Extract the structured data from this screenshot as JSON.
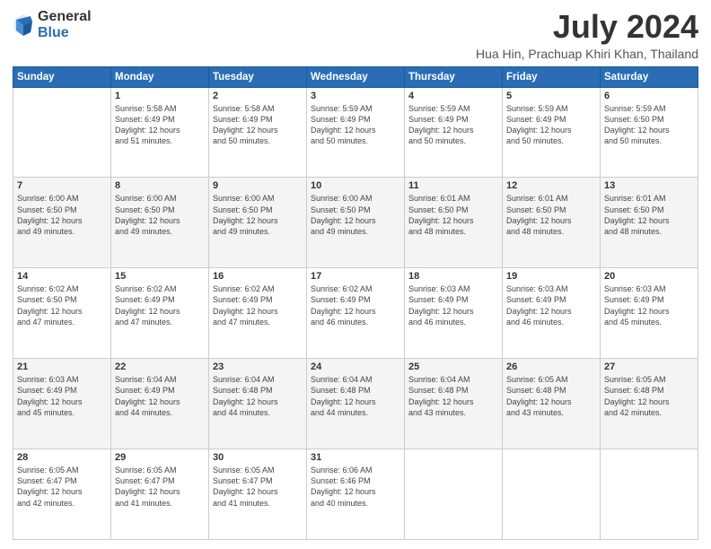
{
  "logo": {
    "general": "General",
    "blue": "Blue"
  },
  "title": "July 2024",
  "subtitle": "Hua Hin, Prachuap Khiri Khan, Thailand",
  "headers": [
    "Sunday",
    "Monday",
    "Tuesday",
    "Wednesday",
    "Thursday",
    "Friday",
    "Saturday"
  ],
  "weeks": [
    [
      {
        "day": "",
        "info": ""
      },
      {
        "day": "1",
        "info": "Sunrise: 5:58 AM\nSunset: 6:49 PM\nDaylight: 12 hours\nand 51 minutes."
      },
      {
        "day": "2",
        "info": "Sunrise: 5:58 AM\nSunset: 6:49 PM\nDaylight: 12 hours\nand 50 minutes."
      },
      {
        "day": "3",
        "info": "Sunrise: 5:59 AM\nSunset: 6:49 PM\nDaylight: 12 hours\nand 50 minutes."
      },
      {
        "day": "4",
        "info": "Sunrise: 5:59 AM\nSunset: 6:49 PM\nDaylight: 12 hours\nand 50 minutes."
      },
      {
        "day": "5",
        "info": "Sunrise: 5:59 AM\nSunset: 6:49 PM\nDaylight: 12 hours\nand 50 minutes."
      },
      {
        "day": "6",
        "info": "Sunrise: 5:59 AM\nSunset: 6:50 PM\nDaylight: 12 hours\nand 50 minutes."
      }
    ],
    [
      {
        "day": "7",
        "info": "Sunrise: 6:00 AM\nSunset: 6:50 PM\nDaylight: 12 hours\nand 49 minutes."
      },
      {
        "day": "8",
        "info": "Sunrise: 6:00 AM\nSunset: 6:50 PM\nDaylight: 12 hours\nand 49 minutes."
      },
      {
        "day": "9",
        "info": "Sunrise: 6:00 AM\nSunset: 6:50 PM\nDaylight: 12 hours\nand 49 minutes."
      },
      {
        "day": "10",
        "info": "Sunrise: 6:00 AM\nSunset: 6:50 PM\nDaylight: 12 hours\nand 49 minutes."
      },
      {
        "day": "11",
        "info": "Sunrise: 6:01 AM\nSunset: 6:50 PM\nDaylight: 12 hours\nand 48 minutes."
      },
      {
        "day": "12",
        "info": "Sunrise: 6:01 AM\nSunset: 6:50 PM\nDaylight: 12 hours\nand 48 minutes."
      },
      {
        "day": "13",
        "info": "Sunrise: 6:01 AM\nSunset: 6:50 PM\nDaylight: 12 hours\nand 48 minutes."
      }
    ],
    [
      {
        "day": "14",
        "info": "Sunrise: 6:02 AM\nSunset: 6:50 PM\nDaylight: 12 hours\nand 47 minutes."
      },
      {
        "day": "15",
        "info": "Sunrise: 6:02 AM\nSunset: 6:49 PM\nDaylight: 12 hours\nand 47 minutes."
      },
      {
        "day": "16",
        "info": "Sunrise: 6:02 AM\nSunset: 6:49 PM\nDaylight: 12 hours\nand 47 minutes."
      },
      {
        "day": "17",
        "info": "Sunrise: 6:02 AM\nSunset: 6:49 PM\nDaylight: 12 hours\nand 46 minutes."
      },
      {
        "day": "18",
        "info": "Sunrise: 6:03 AM\nSunset: 6:49 PM\nDaylight: 12 hours\nand 46 minutes."
      },
      {
        "day": "19",
        "info": "Sunrise: 6:03 AM\nSunset: 6:49 PM\nDaylight: 12 hours\nand 46 minutes."
      },
      {
        "day": "20",
        "info": "Sunrise: 6:03 AM\nSunset: 6:49 PM\nDaylight: 12 hours\nand 45 minutes."
      }
    ],
    [
      {
        "day": "21",
        "info": "Sunrise: 6:03 AM\nSunset: 6:49 PM\nDaylight: 12 hours\nand 45 minutes."
      },
      {
        "day": "22",
        "info": "Sunrise: 6:04 AM\nSunset: 6:49 PM\nDaylight: 12 hours\nand 44 minutes."
      },
      {
        "day": "23",
        "info": "Sunrise: 6:04 AM\nSunset: 6:48 PM\nDaylight: 12 hours\nand 44 minutes."
      },
      {
        "day": "24",
        "info": "Sunrise: 6:04 AM\nSunset: 6:48 PM\nDaylight: 12 hours\nand 44 minutes."
      },
      {
        "day": "25",
        "info": "Sunrise: 6:04 AM\nSunset: 6:48 PM\nDaylight: 12 hours\nand 43 minutes."
      },
      {
        "day": "26",
        "info": "Sunrise: 6:05 AM\nSunset: 6:48 PM\nDaylight: 12 hours\nand 43 minutes."
      },
      {
        "day": "27",
        "info": "Sunrise: 6:05 AM\nSunset: 6:48 PM\nDaylight: 12 hours\nand 42 minutes."
      }
    ],
    [
      {
        "day": "28",
        "info": "Sunrise: 6:05 AM\nSunset: 6:47 PM\nDaylight: 12 hours\nand 42 minutes."
      },
      {
        "day": "29",
        "info": "Sunrise: 6:05 AM\nSunset: 6:47 PM\nDaylight: 12 hours\nand 41 minutes."
      },
      {
        "day": "30",
        "info": "Sunrise: 6:05 AM\nSunset: 6:47 PM\nDaylight: 12 hours\nand 41 minutes."
      },
      {
        "day": "31",
        "info": "Sunrise: 6:06 AM\nSunset: 6:46 PM\nDaylight: 12 hours\nand 40 minutes."
      },
      {
        "day": "",
        "info": ""
      },
      {
        "day": "",
        "info": ""
      },
      {
        "day": "",
        "info": ""
      }
    ]
  ]
}
